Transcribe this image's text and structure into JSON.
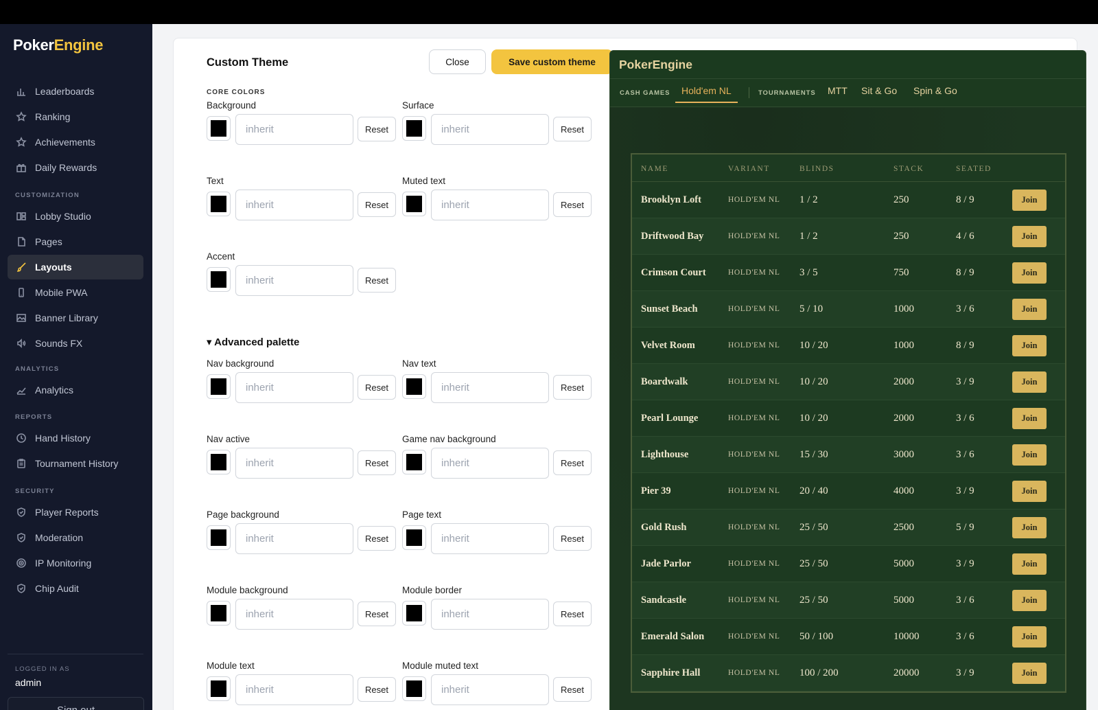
{
  "brand": {
    "part1": "Poker",
    "part2": "Engine"
  },
  "sidebar": {
    "items_top": [
      {
        "label": "Leaderboards",
        "icon": "bar-chart-icon"
      },
      {
        "label": "Ranking",
        "icon": "star-icon"
      },
      {
        "label": "Achievements",
        "icon": "star-icon"
      },
      {
        "label": "Daily Rewards",
        "icon": "gift-icon"
      }
    ],
    "customization_title": "CUSTOMIZATION",
    "items_custom": [
      {
        "label": "Lobby Studio",
        "icon": "layout-icon"
      },
      {
        "label": "Pages",
        "icon": "file-icon"
      },
      {
        "label": "Layouts",
        "icon": "brush-icon",
        "active": true
      },
      {
        "label": "Mobile PWA",
        "icon": "phone-icon"
      },
      {
        "label": "Banner Library",
        "icon": "image-icon"
      },
      {
        "label": "Sounds FX",
        "icon": "speaker-icon"
      }
    ],
    "analytics_title": "ANALYTICS",
    "items_analytics": [
      {
        "label": "Analytics",
        "icon": "line-chart-icon"
      }
    ],
    "reports_title": "REPORTS",
    "items_reports": [
      {
        "label": "Hand History",
        "icon": "clock-icon"
      },
      {
        "label": "Tournament History",
        "icon": "clipboard-icon"
      }
    ],
    "security_title": "SECURITY",
    "items_security": [
      {
        "label": "Player Reports",
        "icon": "shield-icon"
      },
      {
        "label": "Moderation",
        "icon": "shield-icon"
      },
      {
        "label": "IP Monitoring",
        "icon": "radar-icon"
      },
      {
        "label": "Chip Audit",
        "icon": "shield-icon"
      }
    ],
    "logged_in_label": "LOGGED IN AS",
    "user": "admin",
    "sign_out": "Sign out"
  },
  "form": {
    "title": "Custom Theme",
    "close": "Close",
    "save": "Save custom theme",
    "core_title": "CORE COLORS",
    "advanced_title": "▾ Advanced palette",
    "reset": "Reset",
    "placeholder": "inherit",
    "core_fields": [
      "Background",
      "Surface",
      "Text",
      "Muted text",
      "Accent"
    ],
    "advanced_fields": [
      "Nav background",
      "Nav text",
      "Nav active",
      "Game nav background",
      "Page background",
      "Page text",
      "Module background",
      "Module border",
      "Module text",
      "Module muted text"
    ],
    "swatch_color": "#000000"
  },
  "preview": {
    "brand": "PokerEngine",
    "nav": {
      "cash_games": "CASH GAMES",
      "holdem": "Hold'em NL",
      "tournaments": "TOURNAMENTS",
      "mtt": "MTT",
      "sitgo": "Sit & Go",
      "spingo": "Spin & Go"
    },
    "columns": [
      "NAME",
      "VARIANT",
      "BLINDS",
      "STACK",
      "SEATED"
    ],
    "join_label": "Join",
    "rows": [
      {
        "name": "Brooklyn Loft",
        "variant": "HOLD'EM NL",
        "blinds": "1 / 2",
        "stack": "250",
        "seated": "8 / 9"
      },
      {
        "name": "Driftwood Bay",
        "variant": "HOLD'EM NL",
        "blinds": "1 / 2",
        "stack": "250",
        "seated": "4 / 6"
      },
      {
        "name": "Crimson Court",
        "variant": "HOLD'EM NL",
        "blinds": "3 / 5",
        "stack": "750",
        "seated": "8 / 9"
      },
      {
        "name": "Sunset Beach",
        "variant": "HOLD'EM NL",
        "blinds": "5 / 10",
        "stack": "1000",
        "seated": "3 / 6"
      },
      {
        "name": "Velvet Room",
        "variant": "HOLD'EM NL",
        "blinds": "10 / 20",
        "stack": "1000",
        "seated": "8 / 9"
      },
      {
        "name": "Boardwalk",
        "variant": "HOLD'EM NL",
        "blinds": "10 / 20",
        "stack": "2000",
        "seated": "3 / 9"
      },
      {
        "name": "Pearl Lounge",
        "variant": "HOLD'EM NL",
        "blinds": "10 / 20",
        "stack": "2000",
        "seated": "3 / 6"
      },
      {
        "name": "Lighthouse",
        "variant": "HOLD'EM NL",
        "blinds": "15 / 30",
        "stack": "3000",
        "seated": "3 / 6"
      },
      {
        "name": "Pier 39",
        "variant": "HOLD'EM NL",
        "blinds": "20 / 40",
        "stack": "4000",
        "seated": "3 / 9"
      },
      {
        "name": "Gold Rush",
        "variant": "HOLD'EM NL",
        "blinds": "25 / 50",
        "stack": "2500",
        "seated": "5 / 9"
      },
      {
        "name": "Jade Parlor",
        "variant": "HOLD'EM NL",
        "blinds": "25 / 50",
        "stack": "5000",
        "seated": "3 / 9"
      },
      {
        "name": "Sandcastle",
        "variant": "HOLD'EM NL",
        "blinds": "25 / 50",
        "stack": "5000",
        "seated": "3 / 6"
      },
      {
        "name": "Emerald Salon",
        "variant": "HOLD'EM NL",
        "blinds": "50 / 100",
        "stack": "10000",
        "seated": "3 / 6"
      },
      {
        "name": "Sapphire Hall",
        "variant": "HOLD'EM NL",
        "blinds": "100 / 200",
        "stack": "20000",
        "seated": "3 / 9"
      }
    ]
  }
}
